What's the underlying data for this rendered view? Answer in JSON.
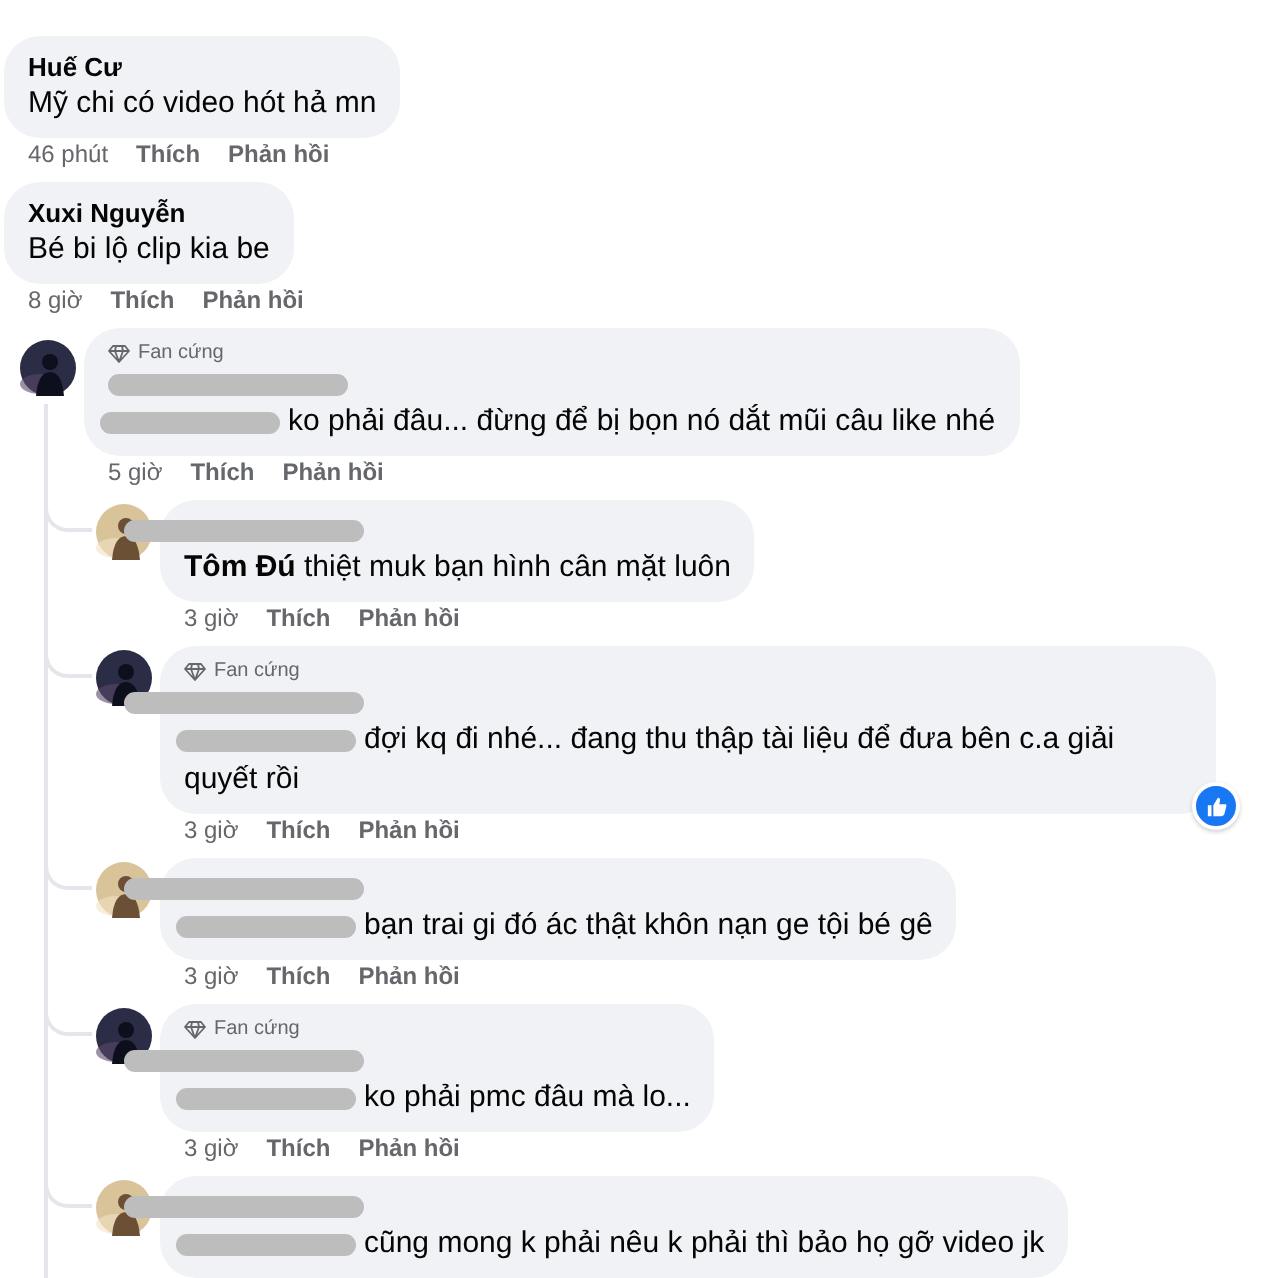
{
  "comments": [
    {
      "author": "Huế Cư",
      "text": "Mỹ chi có video hót hả mn",
      "time": "46 phút",
      "like_label": "Thích",
      "reply_label": "Phản hồi"
    },
    {
      "author": "Xuxi Nguyễn",
      "text": "Bé bi lộ clip kia be",
      "time": "8 giờ",
      "like_label": "Thích",
      "reply_label": "Phản hồi",
      "children": [
        {
          "avatar_dark": true,
          "badge": "Fan cứng",
          "author_redacted": true,
          "mention_redacted": true,
          "text": "ko phải đâu... đừng để bị bọn nó dắt mũi câu like nhé",
          "time": "5 giờ",
          "like_label": "Thích",
          "reply_label": "Phản hồi",
          "liked": false,
          "children": [
            {
              "avatar_dark": false,
              "author_redacted": true,
              "mention": "Tôm Đú",
              "text": "thiệt muk bạn hình cân mặt luôn",
              "time": "3 giờ",
              "like_label": "Thích",
              "reply_label": "Phản hồi",
              "liked": false
            },
            {
              "avatar_dark": true,
              "badge": "Fan cứng",
              "author_redacted": true,
              "mention_redacted": true,
              "text": "đợi kq đi nhé... đang thu thập tài liệu để đưa bên c.a giải quyết rồi",
              "time": "3 giờ",
              "like_label": "Thích",
              "reply_label": "Phản hồi",
              "liked": true
            },
            {
              "avatar_dark": false,
              "author_redacted": true,
              "mention_redacted": true,
              "text": "bạn trai gi đó ác thật khôn nạn ge tội bé gê",
              "time": "3 giờ",
              "like_label": "Thích",
              "reply_label": "Phản hồi",
              "liked": false
            },
            {
              "avatar_dark": true,
              "badge": "Fan cứng",
              "author_redacted": true,
              "mention_redacted": true,
              "text": "ko phải pmc đâu mà lo...",
              "time": "3 giờ",
              "like_label": "Thích",
              "reply_label": "Phản hồi",
              "liked": false
            },
            {
              "avatar_dark": false,
              "author_redacted": true,
              "mention_redacted": true,
              "text": "cũng mong k phải nêu k phải thì bảo họ gỡ video jk",
              "liked": false
            }
          ]
        }
      ]
    }
  ]
}
